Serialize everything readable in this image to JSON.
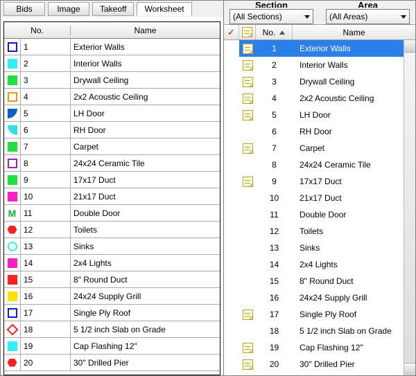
{
  "tabs": {
    "bids": "Bids",
    "image": "Image",
    "takeoff": "Takeoff",
    "worksheet": "Worksheet"
  },
  "left_grid": {
    "header_no": "No.",
    "header_name": "Name",
    "rows": [
      {
        "no": "1",
        "name": "Exterior Walls",
        "shape": "sq-out",
        "color": "#1818cc"
      },
      {
        "no": "2",
        "name": "Interior  Walls",
        "shape": "sq-fill",
        "color": "#30f0ff"
      },
      {
        "no": "3",
        "name": "Drywall Ceiling",
        "shape": "sq-fill",
        "color": "#20e040"
      },
      {
        "no": "4",
        "name": "2x2 Acoustic Ceiling",
        "shape": "sq-out",
        "color": "#ff9000"
      },
      {
        "no": "5",
        "name": "LH Door",
        "shape": "quarter",
        "color": "#1060c0"
      },
      {
        "no": "6",
        "name": "RH Door",
        "shape": "quarterR",
        "color": "#30e0e0"
      },
      {
        "no": "7",
        "name": "Carpet",
        "shape": "sq-fill",
        "color": "#20e040"
      },
      {
        "no": "8",
        "name": "24x24 Ceramic Tile",
        "shape": "sq-out",
        "color": "#a020c0"
      },
      {
        "no": "9",
        "name": "17x17 Duct",
        "shape": "sq-fill",
        "color": "#20e040"
      },
      {
        "no": "10",
        "name": "21x17 Duct",
        "shape": "sq-fill",
        "color": "#ff20c0"
      },
      {
        "no": "11",
        "name": "Double Door",
        "shape": "m",
        "color": "#10b030"
      },
      {
        "no": "12",
        "name": "Toilets",
        "shape": "hex",
        "color": "#ff2020"
      },
      {
        "no": "13",
        "name": "Sinks",
        "shape": "circle",
        "color": "#30f0ff"
      },
      {
        "no": "14",
        "name": "2x4 Lights",
        "shape": "sq-fill",
        "color": "#ff20c0"
      },
      {
        "no": "15",
        "name": "8\" Round Duct",
        "shape": "sq-fill",
        "color": "#ff2020"
      },
      {
        "no": "16",
        "name": "24x24 Supply Grill",
        "shape": "sq-fill",
        "color": "#ffe000"
      },
      {
        "no": "17",
        "name": "Single Ply Roof",
        "shape": "sq-out",
        "color": "#1818cc"
      },
      {
        "no": "18",
        "name": "5 1/2 inch Slab on Grade",
        "shape": "diamond",
        "color": "#ff2020"
      },
      {
        "no": "19",
        "name": "Cap Flashing 12\"",
        "shape": "sq-fill",
        "color": "#30f0ff"
      },
      {
        "no": "20",
        "name": "30\" Drilled Pier",
        "shape": "hex",
        "color": "#ff2020"
      }
    ]
  },
  "right": {
    "section_label": "Section",
    "area_label": "Area",
    "section_value": "(All Sections)",
    "area_value": "(All Areas)",
    "header_no": "No.",
    "header_name": "Name",
    "rows": [
      {
        "no": "1",
        "name": "Exterior Walls",
        "note": true,
        "selected": true
      },
      {
        "no": "2",
        "name": "Interior  Walls",
        "note": true,
        "selected": false
      },
      {
        "no": "3",
        "name": "Drywall Ceiling",
        "note": true,
        "selected": false
      },
      {
        "no": "4",
        "name": "2x2 Acoustic Ceiling",
        "note": true,
        "selected": false
      },
      {
        "no": "5",
        "name": "LH Door",
        "note": true,
        "selected": false
      },
      {
        "no": "6",
        "name": "RH Door",
        "note": false,
        "selected": false
      },
      {
        "no": "7",
        "name": "Carpet",
        "note": true,
        "selected": false
      },
      {
        "no": "8",
        "name": "24x24 Ceramic Tile",
        "note": false,
        "selected": false
      },
      {
        "no": "9",
        "name": "17x17 Duct",
        "note": true,
        "selected": false
      },
      {
        "no": "10",
        "name": "21x17 Duct",
        "note": false,
        "selected": false
      },
      {
        "no": "11",
        "name": "Double Door",
        "note": false,
        "selected": false
      },
      {
        "no": "12",
        "name": "Toilets",
        "note": false,
        "selected": false
      },
      {
        "no": "13",
        "name": "Sinks",
        "note": false,
        "selected": false
      },
      {
        "no": "14",
        "name": "2x4 Lights",
        "note": false,
        "selected": false
      },
      {
        "no": "15",
        "name": "8\" Round Duct",
        "note": false,
        "selected": false
      },
      {
        "no": "16",
        "name": "24x24 Supply Grill",
        "note": false,
        "selected": false
      },
      {
        "no": "17",
        "name": "Single Ply Roof",
        "note": true,
        "selected": false
      },
      {
        "no": "18",
        "name": "5 1/2 inch Slab on Grade",
        "note": false,
        "selected": false
      },
      {
        "no": "19",
        "name": "Cap Flashing 12\"",
        "note": true,
        "selected": false
      },
      {
        "no": "20",
        "name": "30\" Drilled Pier",
        "note": true,
        "selected": false
      }
    ]
  }
}
